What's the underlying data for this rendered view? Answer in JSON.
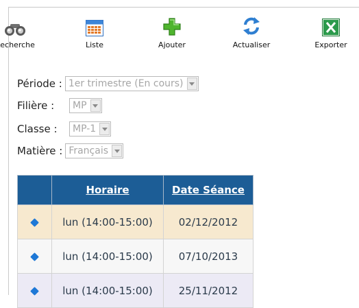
{
  "toolbar": {
    "search_label": "Recherche",
    "list_label": "Liste",
    "add_label": "Ajouter",
    "refresh_label": "Actualiser",
    "export_label": "Exporter"
  },
  "filters": {
    "period": {
      "label": "Période :",
      "value": "1er trimestre (En cours)"
    },
    "stream": {
      "label": "Filière :",
      "value": "MP"
    },
    "class": {
      "label": "Classe :",
      "value": "MP-1"
    },
    "subject": {
      "label": "Matière :",
      "value": "Français"
    }
  },
  "table": {
    "columns": [
      "",
      "Horaire",
      "Date Séance"
    ],
    "rows": [
      {
        "schedule": "lun (14:00-15:00)",
        "date": "02/12/2012"
      },
      {
        "schedule": "lun (14:00-15:00)",
        "date": "07/10/2013"
      },
      {
        "schedule": "lun (14:00-15:00)",
        "date": "25/11/2012"
      }
    ]
  },
  "colors": {
    "header_bg": "#1c5d96",
    "row_selected": "#f7e9cf",
    "row_alt": "#f7f7f7",
    "row_third": "#eceaf5",
    "diamond": "#1e78d6"
  }
}
